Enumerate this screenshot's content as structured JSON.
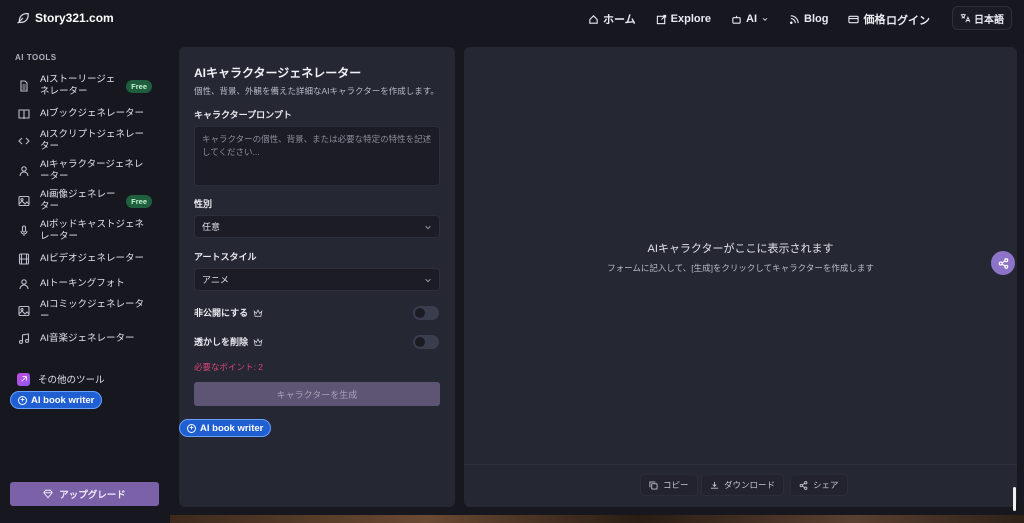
{
  "header": {
    "logo_text": "Story321.com",
    "nav": [
      {
        "label": "ホーム",
        "icon": "home-icon"
      },
      {
        "label": "Explore",
        "icon": "external-link-icon"
      },
      {
        "label": "AI",
        "icon": "robot-icon"
      },
      {
        "label": "Blog",
        "icon": "rss-icon"
      },
      {
        "label": "価格",
        "icon": "card-icon"
      }
    ],
    "login_label": "ログイン",
    "language_label": "日本語"
  },
  "sidebar": {
    "heading": "AI TOOLS",
    "items": [
      {
        "label": "AIストーリージェネレーター",
        "icon": "document-icon",
        "badge": "Free"
      },
      {
        "label": "AIブックジェネレーター",
        "icon": "book-icon",
        "badge": ""
      },
      {
        "label": "AIスクリプトジェネレーター",
        "icon": "code-icon",
        "badge": ""
      },
      {
        "label": "AIキャラクタージェネレーター",
        "icon": "user-icon",
        "badge": ""
      },
      {
        "label": "AI画像ジェネレーター",
        "icon": "image-icon",
        "badge": "Free"
      },
      {
        "label": "AIポッドキャストジェネレーター",
        "icon": "microphone-icon",
        "badge": ""
      },
      {
        "label": "AIビデオジェネレーター",
        "icon": "film-icon",
        "badge": ""
      },
      {
        "label": "AIトーキングフォト",
        "icon": "user-icon",
        "badge": ""
      },
      {
        "label": "AIコミックジェネレーター",
        "icon": "image-icon",
        "badge": ""
      },
      {
        "label": "AI音楽ジェネレーター",
        "icon": "music-icon",
        "badge": ""
      }
    ],
    "other_tools_label": "その他のツール",
    "book_writer_label": "AI book writer",
    "upgrade_label": "アップグレード"
  },
  "form": {
    "title": "AIキャラクタージェネレーター",
    "description": "個性、背景、外観を備えた詳細なAIキャラクターを作成します。",
    "prompt_label": "キャラクタープロンプト",
    "prompt_placeholder": "キャラクターの個性、背景、または必要な特定の特性を記述してください...",
    "gender_label": "性別",
    "gender_value": "任意",
    "art_style_label": "アートスタイル",
    "art_style_value": "アニメ",
    "private_label": "非公開にする",
    "watermark_label": "透かしを削除",
    "points_text": "必要なポイント: 2",
    "generate_label": "キャラクターを生成",
    "book_writer_label": "AI book writer"
  },
  "output": {
    "title": "AIキャラクターがここに表示されます",
    "subtitle": "フォームに記入して、[生成]をクリックしてキャラクターを作成します",
    "copy_label": "コピー",
    "download_label": "ダウンロード",
    "share_label": "シェア"
  },
  "colors": {
    "background": "#17181f",
    "panel": "#252733",
    "accent_purple": "#8e74c8",
    "free_badge": "#1f5f3e",
    "points_pink": "#d9457a",
    "book_writer_blue": "#1f5fd1"
  }
}
